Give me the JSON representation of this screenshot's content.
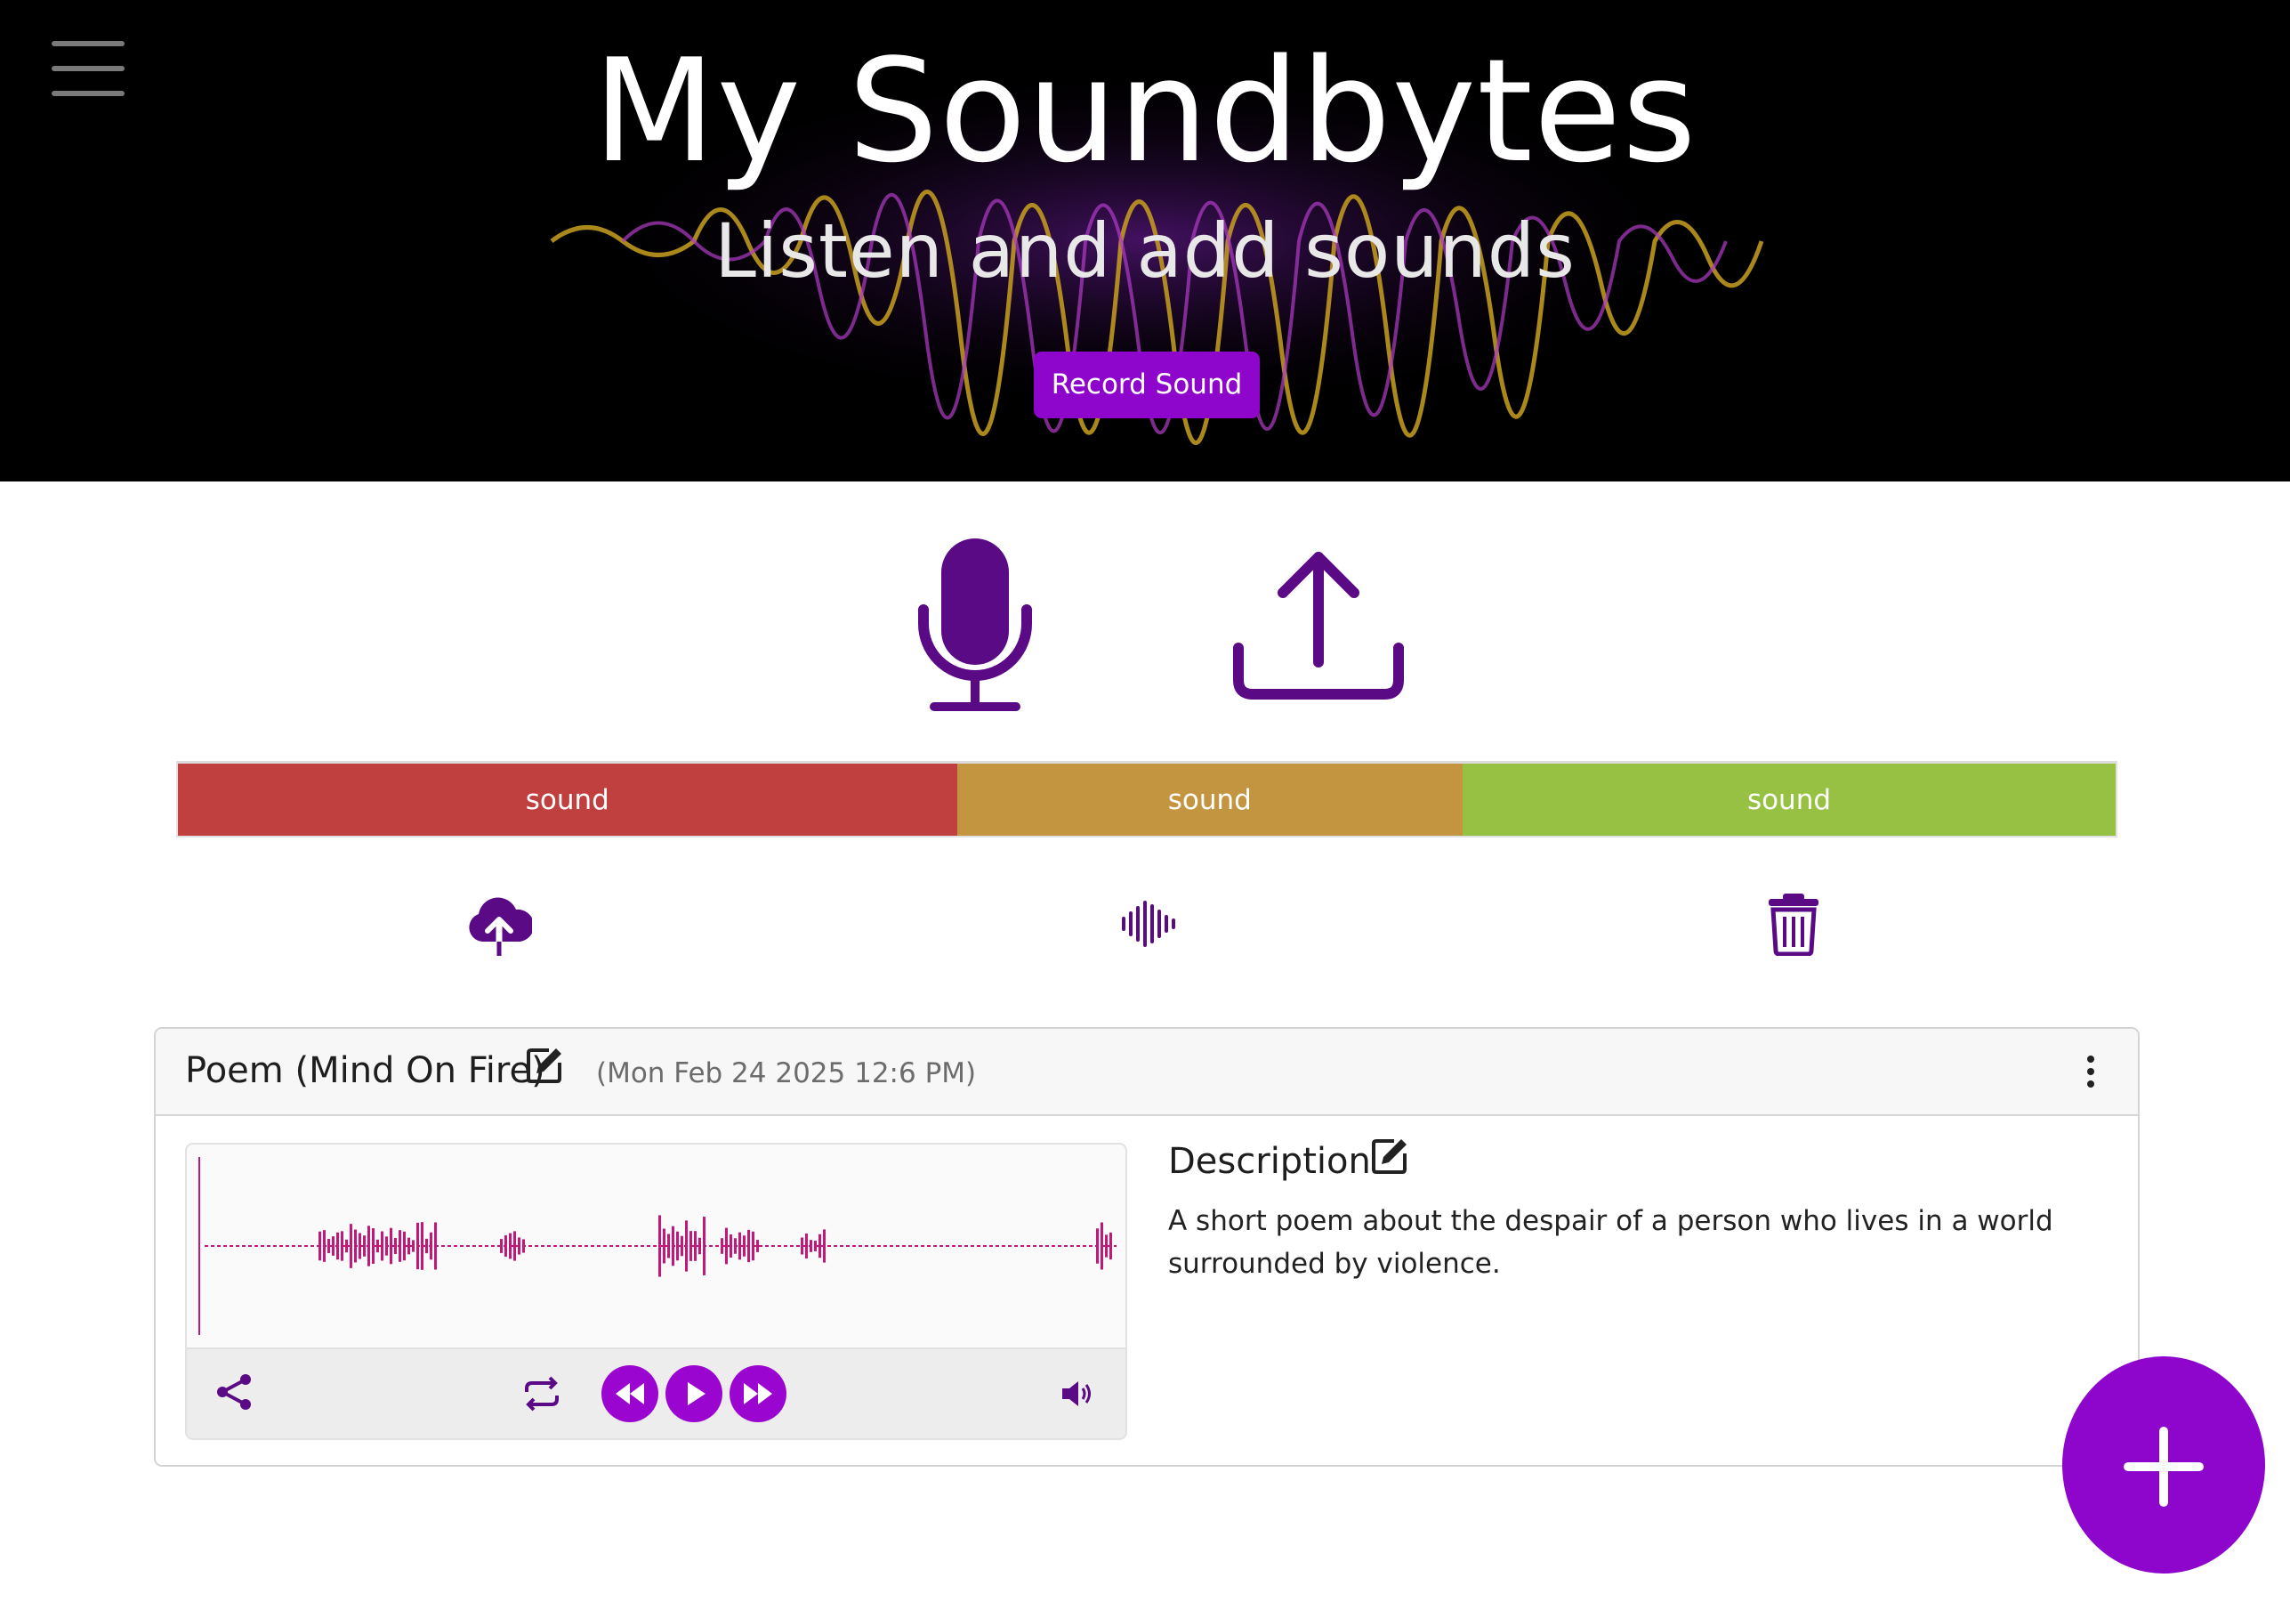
{
  "header": {
    "title": "My Soundbytes",
    "subtitle": "Listen and add sounds",
    "record_button": "Record Sound"
  },
  "colors": {
    "accent": "#8e05cc",
    "icon_purple": "#5b0a85",
    "waveform": "#c2187a",
    "segment_red": "#c04040",
    "segment_orange": "#c49540",
    "segment_green": "#96c142"
  },
  "big_icons": [
    "microphone-icon",
    "upload-icon"
  ],
  "segments": [
    {
      "label": "sound",
      "share": 0.402
    },
    {
      "label": "sound",
      "share": 0.261
    },
    {
      "label": "sound",
      "share": 0.337
    }
  ],
  "actions": [
    "cloud-upload-icon",
    "audio-waveform-icon",
    "trash-icon"
  ],
  "card": {
    "title": "Poem (Mind On Fire)",
    "date": "(Mon Feb 24 2025 12:6 PM)",
    "description_title": "Description",
    "description": "A short poem about the despair of a person who lives in a world surrounded by violence."
  },
  "player_icons": [
    "share-icon",
    "repeat-icon",
    "rewind-icon",
    "play-icon",
    "fast-forward-icon",
    "volume-icon"
  ],
  "fab_icon": "plus-icon"
}
